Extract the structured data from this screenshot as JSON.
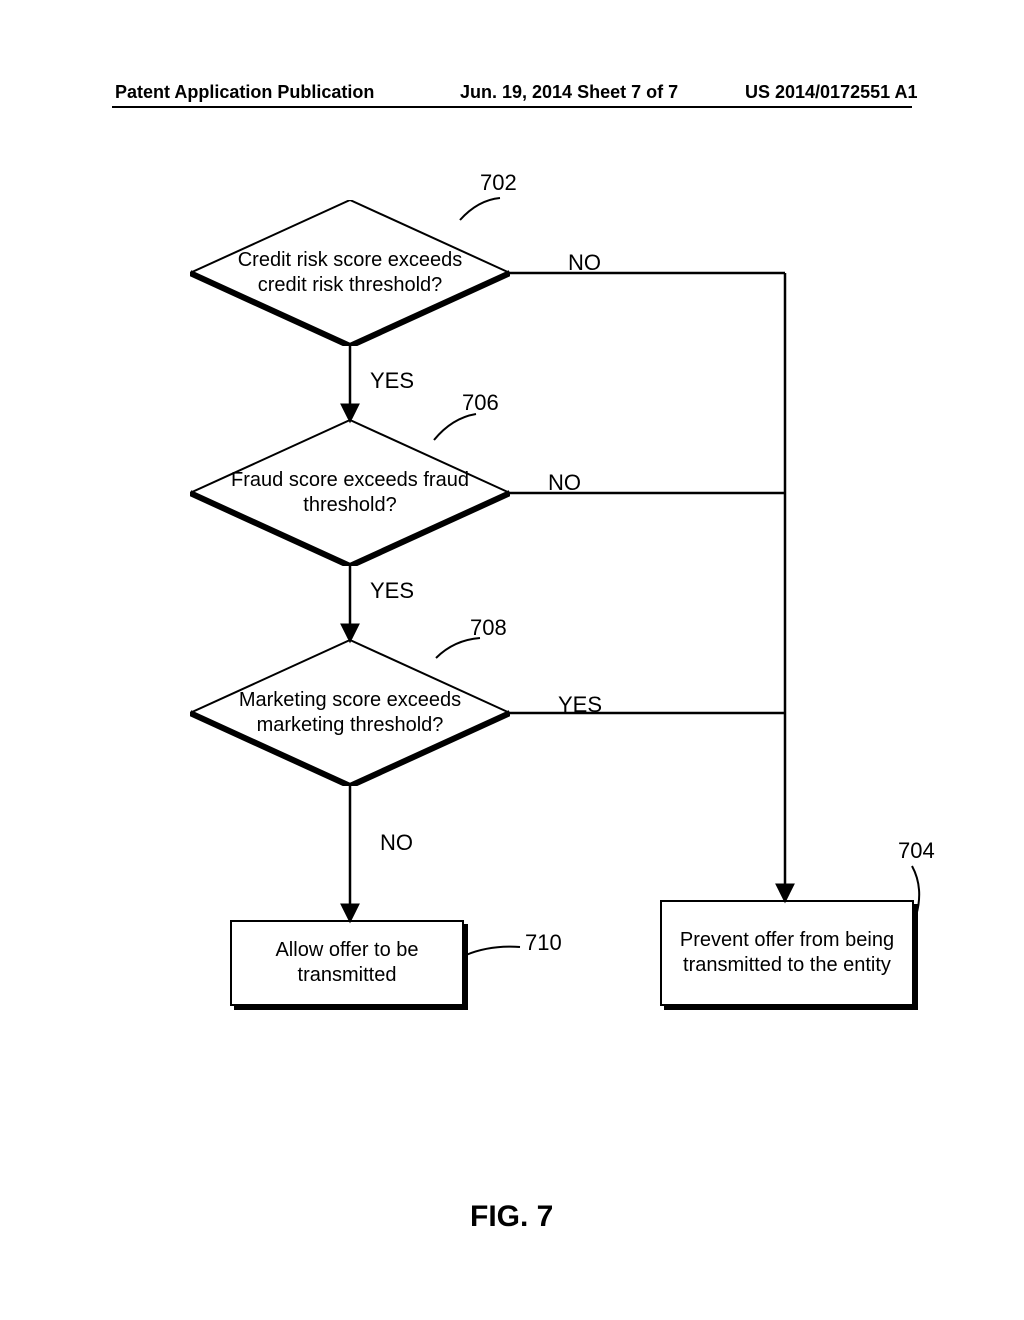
{
  "header": {
    "left": "Patent Application Publication",
    "mid": "Jun. 19, 2014  Sheet 7 of 7",
    "right": "US 2014/0172551 A1"
  },
  "figure": {
    "caption": "FIG. 7"
  },
  "nodes": {
    "d702": {
      "ref": "702",
      "text": "Credit risk score exceeds credit risk threshold?"
    },
    "d706": {
      "ref": "706",
      "text": "Fraud score exceeds fraud threshold?"
    },
    "d708": {
      "ref": "708",
      "text": "Marketing score exceeds marketing threshold?"
    },
    "p710": {
      "ref": "710",
      "text": "Allow offer to be transmitted"
    },
    "p704": {
      "ref": "704",
      "text": "Prevent offer from being transmitted to the entity"
    }
  },
  "edges": {
    "d702_right": "NO",
    "d702_down": "YES",
    "d706_right": "NO",
    "d706_down": "YES",
    "d708_right": "YES",
    "d708_down": "NO"
  }
}
